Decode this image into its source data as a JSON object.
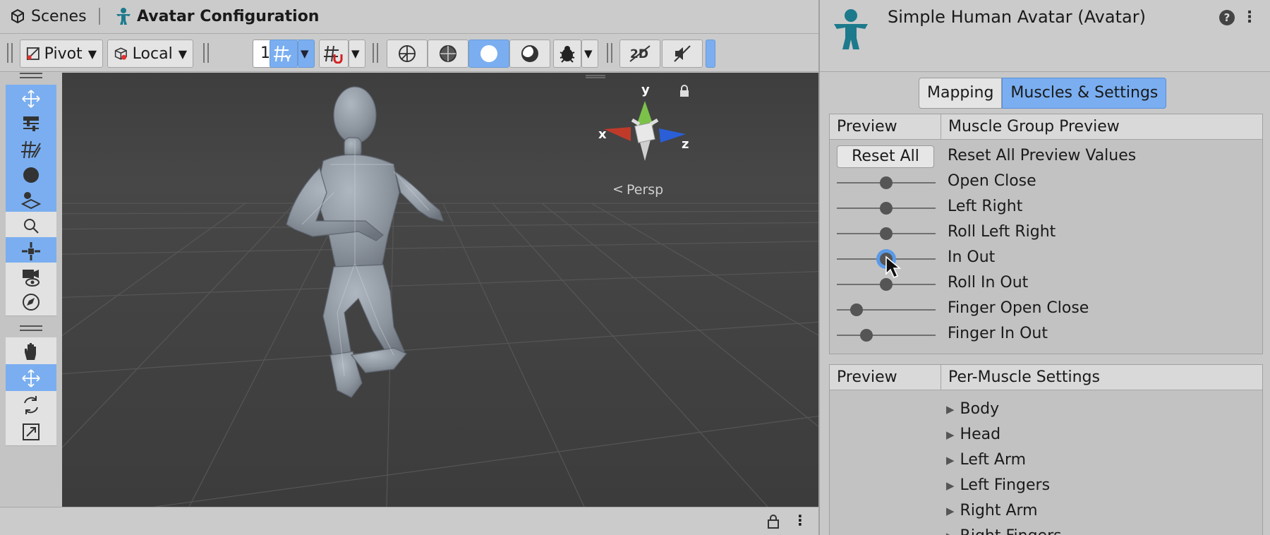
{
  "scene_tabs": {
    "scenes": "Scenes",
    "avatar_config": "Avatar Configuration"
  },
  "toolbar": {
    "pivot": "Pivot",
    "local": "Local",
    "grid_value": "1"
  },
  "viewport": {
    "projection_label": "Persp",
    "axes": {
      "x": "x",
      "y": "y",
      "z": "z"
    }
  },
  "inspector": {
    "title": "Simple Human Avatar (Avatar)",
    "help": "?",
    "tabs": {
      "mapping": "Mapping",
      "muscles": "Muscles & Settings"
    },
    "group_preview": {
      "col_preview": "Preview",
      "col_title": "Muscle Group Preview",
      "reset_button": "Reset All",
      "reset_label": "Reset All Preview Values",
      "sliders": [
        {
          "label": "Open Close",
          "value": 0.5
        },
        {
          "label": "Left Right",
          "value": 0.5
        },
        {
          "label": "Roll Left Right",
          "value": 0.5
        },
        {
          "label": "In Out",
          "value": 0.5
        },
        {
          "label": "Roll In Out",
          "value": 0.5
        },
        {
          "label": "Finger Open Close",
          "value": 0.2
        },
        {
          "label": "Finger In Out",
          "value": 0.3
        }
      ]
    },
    "per_muscle": {
      "col_preview": "Preview",
      "col_title": "Per-Muscle Settings",
      "items": [
        "Body",
        "Head",
        "Left Arm",
        "Left Fingers",
        "Right Arm",
        "Right Fingers"
      ]
    }
  }
}
